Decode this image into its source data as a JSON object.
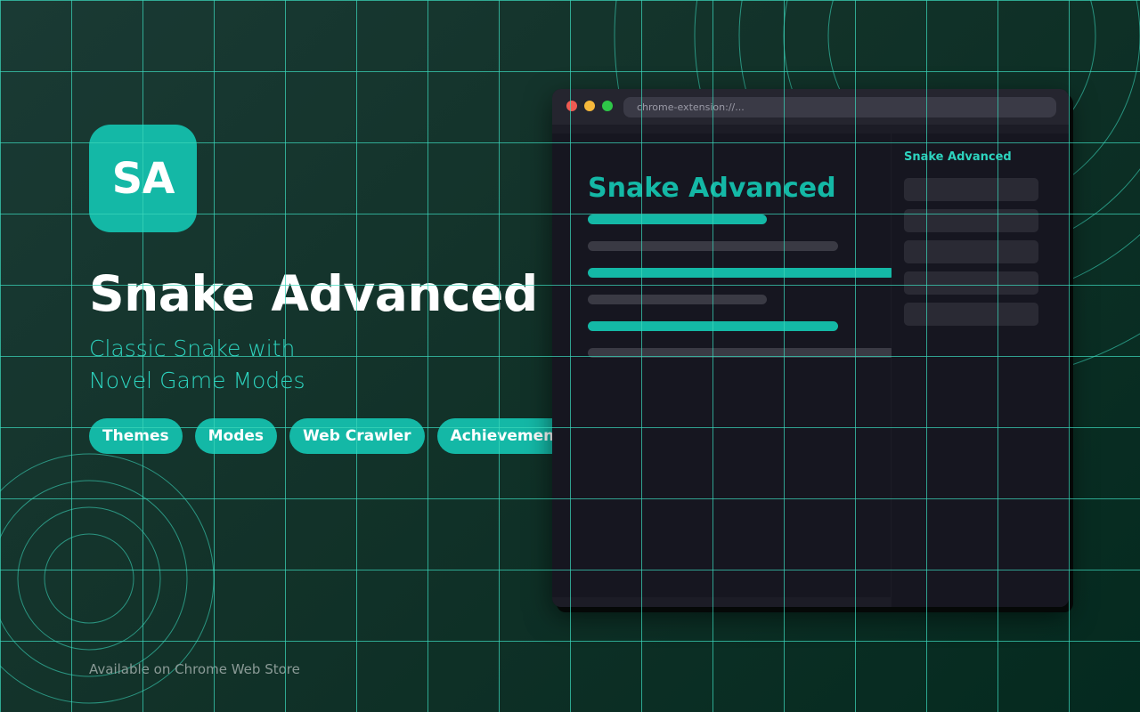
{
  "logo": {
    "text": "SA"
  },
  "hero": {
    "title": "Snake Advanced",
    "subtitle_lines": [
      "Classic Snake with",
      "Novel Game Modes"
    ]
  },
  "tags": [
    "Themes",
    "Modes",
    "Web Crawler",
    "Achievements"
  ],
  "footer": {
    "text": "Available on Chrome Web Store"
  },
  "browser": {
    "url": "chrome-extension://...",
    "app_heading": "Snake Advanced",
    "sidebar_title": "Snake Advanced"
  },
  "colors": {
    "accent": "#14b8a6",
    "accent_light": "#2dd4bf",
    "background": "#123229",
    "window": "#16161e"
  }
}
